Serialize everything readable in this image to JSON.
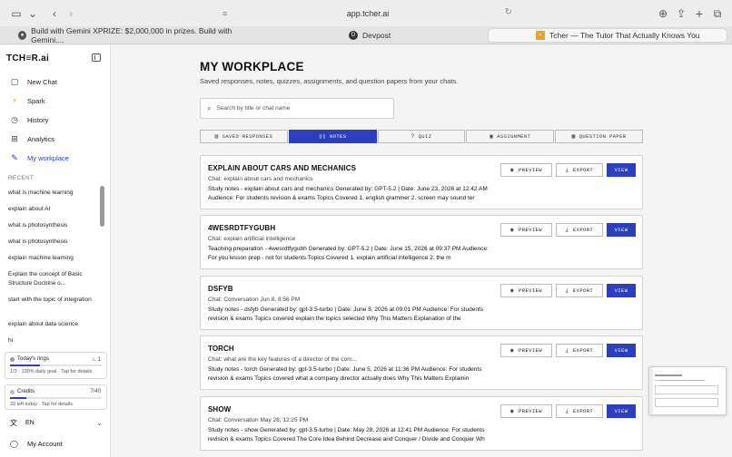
{
  "browser": {
    "url": "app.tcher.ai",
    "tabs": [
      {
        "label": "Build with Gemini XPRIZE: $2,000,000 in prizes. Build with Gemini...."
      },
      {
        "label": "Devpost"
      },
      {
        "label": "Tcher — The Tutor That Actually Knows You"
      }
    ]
  },
  "sidebar": {
    "logo": "TCH≡R.ai",
    "nav": [
      {
        "label": "New Chat",
        "icon": "new-chat-icon"
      },
      {
        "label": "Spark",
        "icon": "lightning-icon"
      },
      {
        "label": "History",
        "icon": "clock-icon"
      },
      {
        "label": "Analytics",
        "icon": "grid-icon"
      },
      {
        "label": "My workplace",
        "icon": "edit-icon"
      }
    ],
    "recent_heading": "RECENT",
    "recent": [
      "what is machine learning",
      "explain about AI",
      "what is photosynthesis",
      "what is photosynthesis",
      "explain machine learning",
      "Explain the concept of Basic Structure Doctrine o...",
      "start with the topic of integration",
      "explain about data science",
      "hi"
    ],
    "rings": {
      "title": "Today's rings",
      "count": "1",
      "sub": "1/3 · 100% daily goal · Tap for details",
      "progress": 0.33
    },
    "credits": {
      "title": "Credits",
      "count": "7/40",
      "sub": "33 left today · Tap for details",
      "progress": 0.175
    },
    "language": "EN",
    "account": "My Account"
  },
  "main": {
    "title": "MY WORKPLACE",
    "subtitle": "Saved responses, notes, quizzes, assignments, and question papers from your chats.",
    "search_placeholder": "Search by title or chat name",
    "segments": [
      {
        "label": "SAVED RESPONSES"
      },
      {
        "label": "NOTES"
      },
      {
        "label": "QUIZ"
      },
      {
        "label": "ASSIGNMENT"
      },
      {
        "label": "QUESTION PAPER"
      }
    ],
    "actions": {
      "preview": "PREVIEW",
      "export": "EXPORT",
      "view": "VIEW"
    },
    "cards": [
      {
        "title": "EXPLAIN ABOUT CARS AND MECHANICS",
        "chat": "Chat: explain about cars and mechanics",
        "desc": "Study notes - explain about cars and mechanics Generated by: GPT-5.2 | Date: June 23, 2026 at 12:42 AM Audience: For students revision & exams Topics Covered 1. english grammer 2. screen may sound ter"
      },
      {
        "title": "4WESRDTFYGUBH",
        "chat": "Chat: explain artificial intelligence",
        "desc": "Teaching preparation - 4wesrdtfygubh Generated by: GPT-5.2 | Date: June 15, 2026 at 09:37 PM Audience: For you lesson prep - not for students Topics Covered 1. explain artificial intelligence 2. the m"
      },
      {
        "title": "DSFYB",
        "chat": "Chat: Conversation Jun 8, 8:56 PM",
        "desc": "Study notes - dsfyb Generated by: gpt-3.5-turbo | Date: June 8, 2026 at 09:01 PM Audience: For students revision & exams Topics covered explain the topics selected Why This Matters Explanation of the"
      },
      {
        "title": "TORCH",
        "chat": "Chat: what are the key features of a director of the com...",
        "desc": "Study notes - torch Generated by: gpt-3.5-turbo | Date: June 5, 2026 at 11:36 PM Audience: For students revision & exams Topics covered what a company director actually does Why This Matters Explainin"
      },
      {
        "title": "SHOW",
        "chat": "Chat: Conversation May 28, 12:25 PM",
        "desc": "Study notes - show Generated by: gpt-3.5-turbo | Date: May 28, 2026 at 12:41 PM Audience: For students revision & exams Topics Covered The Core Idea Behind Decrease and Conquer / Divide and Conquer Wh"
      }
    ]
  },
  "colors": {
    "accent": "#2b3fbf"
  }
}
